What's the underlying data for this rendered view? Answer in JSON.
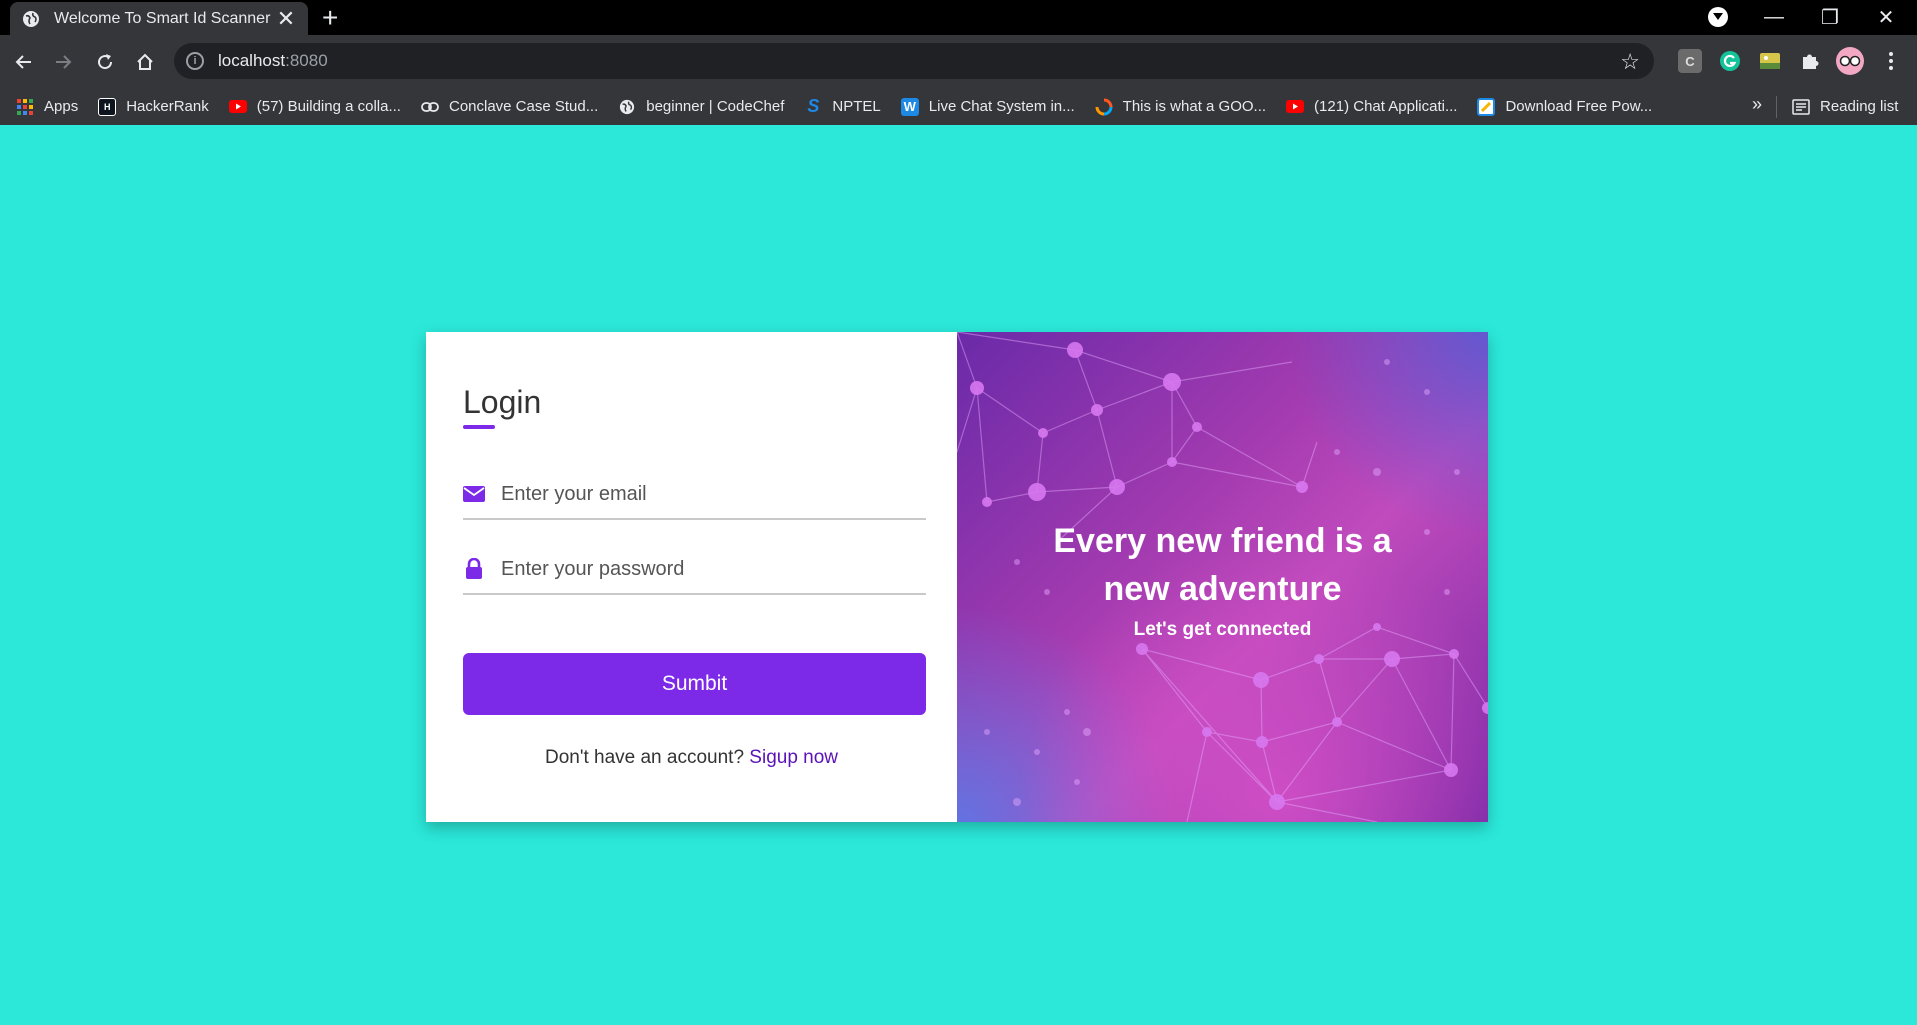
{
  "browser": {
    "tab_title": "Welcome To Smart Id Scanner",
    "tab_close": "✕",
    "new_tab": "+",
    "url_host": "localhost",
    "url_port": ":8080",
    "window_controls": {
      "minimize": "—",
      "maximize": "❐",
      "close": "✕"
    },
    "bookmarks": [
      {
        "label": "Apps",
        "icon": "apps-grid-icon"
      },
      {
        "label": "HackerRank",
        "icon": "hackerrank-icon"
      },
      {
        "label": "(57) Building a colla...",
        "icon": "youtube-icon"
      },
      {
        "label": "Conclave Case Stud...",
        "icon": "link-icon"
      },
      {
        "label": "beginner | CodeChef",
        "icon": "globe-icon"
      },
      {
        "label": "NPTEL",
        "icon": "nptel-icon"
      },
      {
        "label": "Live Chat System in...",
        "icon": "w-icon"
      },
      {
        "label": "This is what a GOO...",
        "icon": "swirl-icon"
      },
      {
        "label": "(121) Chat Applicati...",
        "icon": "youtube-icon"
      },
      {
        "label": "Download Free Pow...",
        "icon": "download-site-icon"
      }
    ],
    "bookmarks_more": "»",
    "reading_list": "Reading list"
  },
  "login": {
    "title": "Login",
    "email_placeholder": "Enter your email",
    "password_placeholder": "Enter your password",
    "submit_label": "Sumbit",
    "signup_prompt": "Don't have an account?",
    "signup_link": "Sigup now"
  },
  "hero": {
    "title_line1": "Every new friend is a",
    "title_line2": "new adventure",
    "subtitle": "Let's get connected"
  },
  "colors": {
    "page_background": "#2be8d9",
    "accent": "#7d2ae8",
    "link": "#5b13b9"
  }
}
